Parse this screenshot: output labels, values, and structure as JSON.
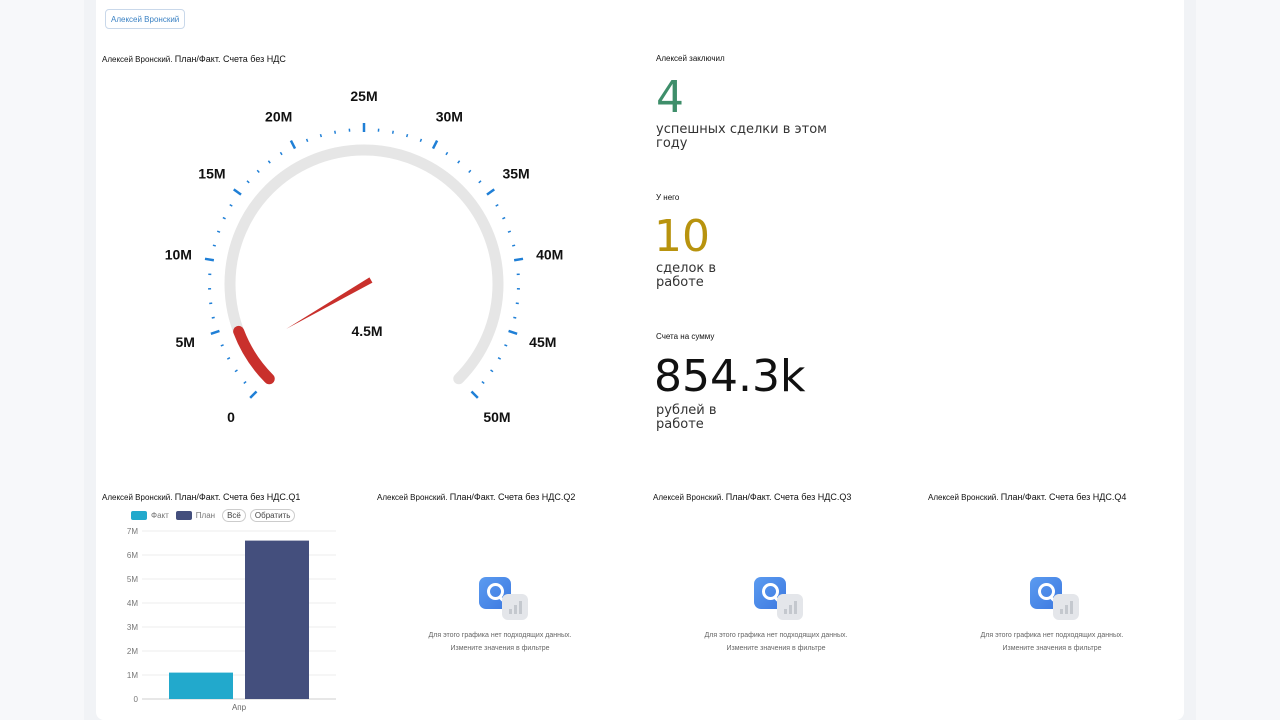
{
  "user_chip": "Алексей Вронский",
  "gauge": {
    "title_prefix": "Алексей Вронский.",
    "title": "План/Факт. Счета без НДС",
    "value_label": "4.5M",
    "value": 4.5,
    "min": 0,
    "max": 50,
    "tick_labels": [
      "0",
      "5M",
      "10M",
      "15M",
      "20M",
      "25M",
      "30M",
      "35M",
      "40M",
      "45M",
      "50M"
    ],
    "colors": {
      "track": "#e6e6e6",
      "progress": "#c9302c",
      "needle": "#c9302c",
      "ticks": "#1f7fd6"
    }
  },
  "kpis": [
    {
      "head": "Алексей заключил",
      "number": "4",
      "desc_line1": "успешных сделки в этом",
      "desc_line2": "году",
      "color": "#3e8e6a"
    },
    {
      "head": "У него",
      "number": "10",
      "desc_line1": "сделок в",
      "desc_line2": "работе",
      "color": "#b8930e"
    },
    {
      "head": "Счета на сумму",
      "number": "854.3k",
      "desc_line1": "рублей в",
      "desc_line2": "работе",
      "color": "#111111"
    }
  ],
  "quarters": [
    {
      "prefix": "Алексей Вронский.",
      "title": "План/Факт. Счета без НДС.Q1"
    },
    {
      "prefix": "Алексей Вронский.",
      "title": "План/Факт. Счета без НДС.Q2"
    },
    {
      "prefix": "Алексей Вронский.",
      "title": "План/Факт. Счета без НДС.Q3"
    },
    {
      "prefix": "Алексей Вронский.",
      "title": "План/Факт. Счета без НДС.Q4"
    }
  ],
  "legend": {
    "fact": "Факт",
    "plan": "План",
    "all": "Всё",
    "invert": "Обратить"
  },
  "no_data": {
    "line1": "Для этого графика нет подходящих данных.",
    "line2": "Измените значения в фильтре"
  },
  "chart_data": {
    "type": "bar",
    "categories": [
      "Апр"
    ],
    "series": [
      {
        "name": "Факт",
        "values": [
          1.1
        ],
        "color": "#22a9cc"
      },
      {
        "name": "План",
        "values": [
          6.6
        ],
        "color": "#444f7d"
      }
    ],
    "yticks": [
      "0",
      "1M",
      "2M",
      "3M",
      "4M",
      "5M",
      "6M",
      "7M"
    ],
    "ylim": [
      0,
      7
    ]
  }
}
